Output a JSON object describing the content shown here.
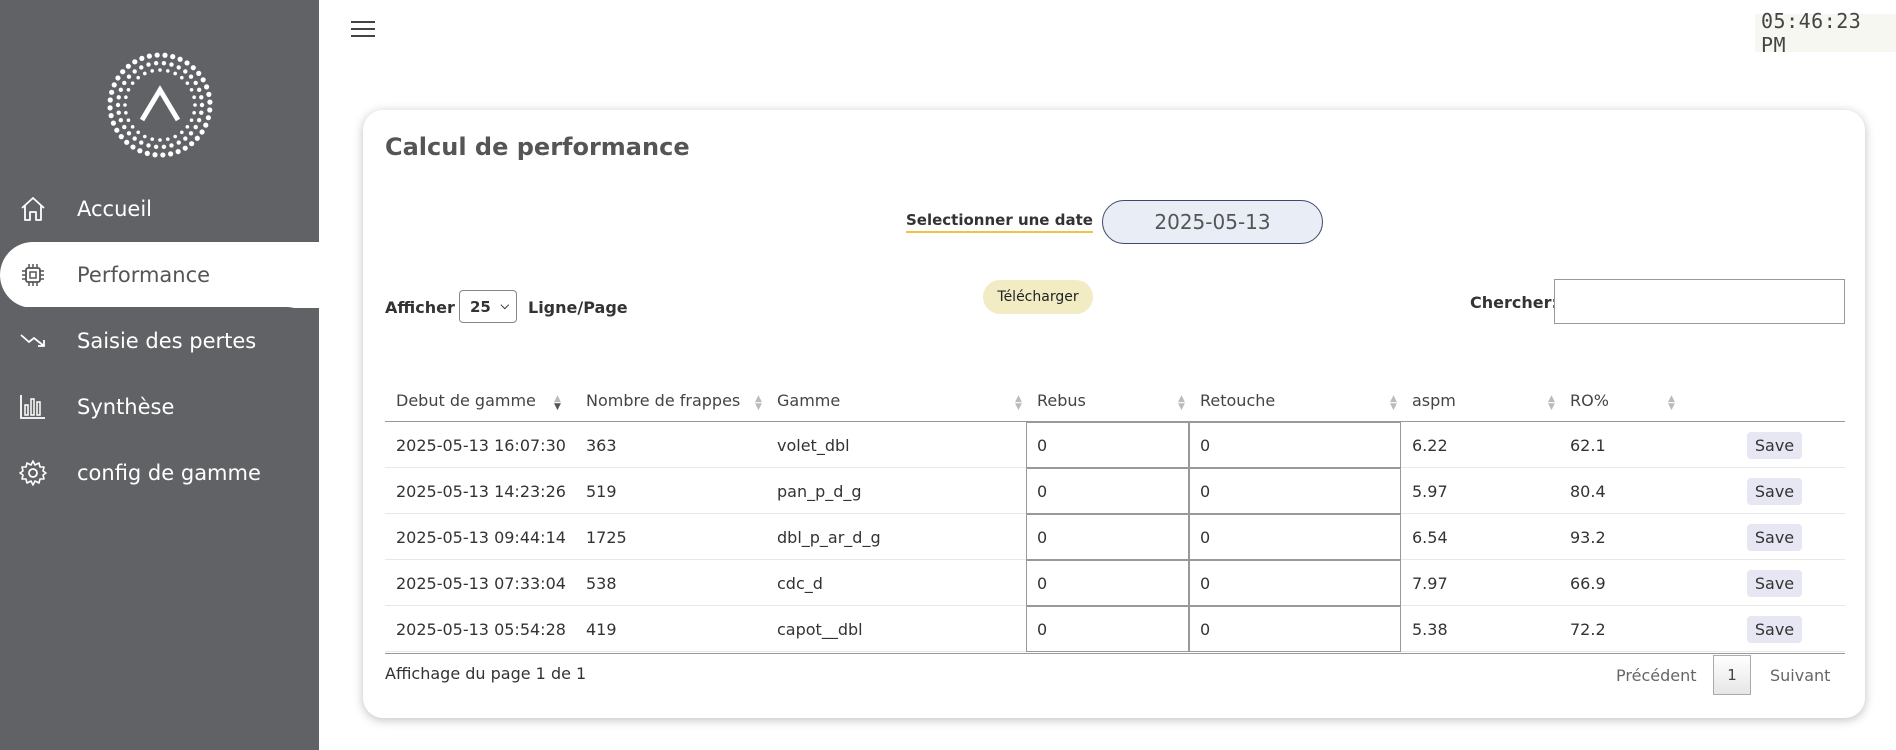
{
  "sidebar": {
    "items": [
      {
        "label": "Accueil",
        "icon": "home-icon"
      },
      {
        "label": "Performance",
        "icon": "chip-icon",
        "active": true
      },
      {
        "label": "Saisie des pertes",
        "icon": "trend-down-icon"
      },
      {
        "label": "Synthèse",
        "icon": "bar-chart-icon"
      },
      {
        "label": "config de gamme",
        "icon": "gear-icon"
      }
    ]
  },
  "header": {
    "clock": "05:46:23 PM"
  },
  "card": {
    "title": "Calcul de performance",
    "date_label": "Selectionner une date",
    "date_value": "2025-05-13",
    "afficher_label": "Afficher",
    "page_size": "25",
    "ligne_label": "Ligne/Page",
    "download_label": "Télécharger",
    "search_label": "Chercher:",
    "search_value": ""
  },
  "table": {
    "headers": [
      "Debut de gamme",
      "Nombre de frappes",
      "Gamme",
      "Rebus",
      "Retouche",
      "aspm",
      "RO%"
    ],
    "rows": [
      {
        "debut": "2025-05-13 16:07:30",
        "frappes": "363",
        "gamme": "volet_dbl",
        "rebus": "0",
        "retouche": "0",
        "aspm": "6.22",
        "ro": "62.1",
        "save": "Save"
      },
      {
        "debut": "2025-05-13 14:23:26",
        "frappes": "519",
        "gamme": "pan_p_d_g",
        "rebus": "0",
        "retouche": "0",
        "aspm": "5.97",
        "ro": "80.4",
        "save": "Save"
      },
      {
        "debut": "2025-05-13 09:44:14",
        "frappes": "1725",
        "gamme": "dbl_p_ar_d_g",
        "rebus": "0",
        "retouche": "0",
        "aspm": "6.54",
        "ro": "93.2",
        "save": "Save"
      },
      {
        "debut": "2025-05-13 07:33:04",
        "frappes": "538",
        "gamme": "cdc_d",
        "rebus": "0",
        "retouche": "0",
        "aspm": "7.97",
        "ro": "66.9",
        "save": "Save"
      },
      {
        "debut": "2025-05-13 05:54:28",
        "frappes": "419",
        "gamme": "capot__dbl",
        "rebus": "0",
        "retouche": "0",
        "aspm": "5.38",
        "ro": "72.2",
        "save": "Save"
      }
    ]
  },
  "pagination": {
    "info": "Affichage du page 1 de 1",
    "prev": "Précédent",
    "current": "1",
    "next": "Suivant"
  }
}
